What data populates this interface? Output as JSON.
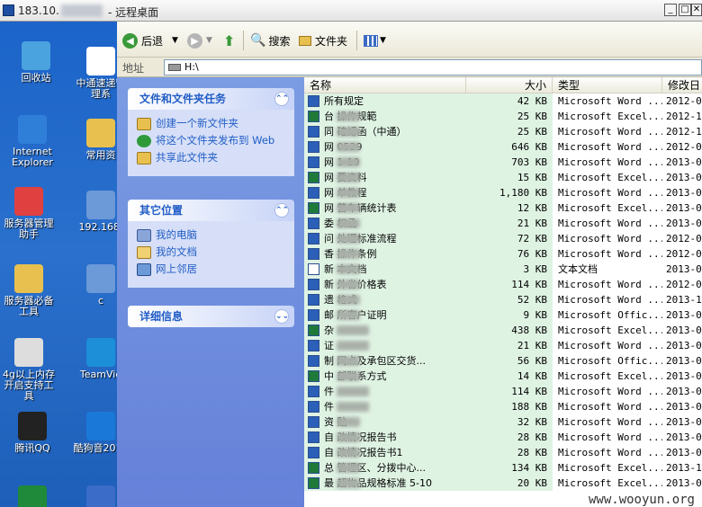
{
  "remote_window": {
    "title_prefix": "183.10.",
    "title_suffix": "- 远程桌面",
    "btn_minimize": "_",
    "btn_restore": "□",
    "btn_close": "✕"
  },
  "desktop_icons": [
    {
      "label": "回收站"
    },
    {
      "label": "中通速递管理系"
    },
    {
      "label": "Internet Explorer"
    },
    {
      "label": "常用资"
    },
    {
      "label": "服务器管理助手"
    },
    {
      "label": "192.168."
    },
    {
      "label": "服务器必备工具"
    },
    {
      "label": "c"
    },
    {
      "label": "4g以上内存开启支持工具"
    },
    {
      "label": "TeamVie"
    },
    {
      "label": "腾讯QQ"
    },
    {
      "label": "酷狗音2012"
    },
    {
      "label": ""
    },
    {
      "label": ""
    }
  ],
  "toolbar": {
    "back": "后退",
    "search": "搜索",
    "folders": "文件夹"
  },
  "address": {
    "label": "地址",
    "value": "H:\\"
  },
  "panels": {
    "tasks": {
      "title": "文件和文件夹任务",
      "links": [
        "创建一个新文件夹",
        "将这个文件夹发布到 Web",
        "共享此文件夹"
      ]
    },
    "places": {
      "title": "其它位置",
      "links": [
        "我的电脑",
        "我的文档",
        "网上邻居"
      ]
    },
    "details": {
      "title": "详细信息"
    }
  },
  "columns": {
    "name": "名称",
    "size": "大小",
    "type": "类型",
    "modified": "修改日"
  },
  "files": [
    {
      "name": "所有规定",
      "size": "42 KB",
      "type": "Microsoft Word ...",
      "mod": "2012-0"
    },
    {
      "name": "台 操作规範",
      "size": "25 KB",
      "type": "Microsoft Excel...",
      "mod": "2012-1"
    },
    {
      "name": "同 確認函（中通）",
      "size": "25 KB",
      "type": "Microsoft Word ...",
      "mod": "2012-1"
    },
    {
      "name": "网 0529",
      "size": "646 KB",
      "type": "Microsoft Word ...",
      "mod": "2012-0"
    },
    {
      "name": "网 1-10",
      "size": "703 KB",
      "type": "Microsoft Word ...",
      "mod": "2013-0"
    },
    {
      "name": "网 要资料",
      "size": "15 KB",
      "type": "Microsoft Excel...",
      "mod": "2013-0"
    },
    {
      "name": "网 单教程",
      "size": "1,180 KB",
      "type": "Microsoft Word ...",
      "mod": "2013-0"
    },
    {
      "name": "网 营车辆统计表",
      "size": "12 KB",
      "type": "Microsoft Excel...",
      "mod": "2013-0"
    },
    {
      "name": "委 权函",
      "size": "21 KB",
      "type": "Microsoft Word ...",
      "mod": "2013-0"
    },
    {
      "name": "问 处理标准流程",
      "size": "72 KB",
      "type": "Microsoft Word ...",
      "mod": "2012-0"
    },
    {
      "name": "香 操作条例",
      "size": "76 KB",
      "type": "Microsoft Word ...",
      "mod": "2012-0"
    },
    {
      "name": "新 本文档",
      "size": "3 KB",
      "type": "文本文档",
      "mod": "2013-0"
    },
    {
      "name": "新 外省价格表",
      "size": "114 KB",
      "type": "Microsoft Word ...",
      "mod": "2012-0"
    },
    {
      "name": "遗 格式",
      "size": "52 KB",
      "type": "Microsoft Word ...",
      "mod": "2013-1"
    },
    {
      "name": "邮 所客户证明",
      "size": "9 KB",
      "type": "Microsoft Offic...",
      "mod": "2013-0"
    },
    {
      "name": "杂",
      "size": "438 KB",
      "type": "Microsoft Excel...",
      "mod": "2013-0"
    },
    {
      "name": "证",
      "size": "21 KB",
      "type": "Microsoft Word ...",
      "mod": "2013-0"
    },
    {
      "name": "制 网点及承包区交货...",
      "size": "56 KB",
      "type": "Microsoft Offic...",
      "mod": "2013-0"
    },
    {
      "name": "中 部联系方式",
      "size": "14 KB",
      "type": "Microsoft Excel...",
      "mod": "2013-0"
    },
    {
      "name": "件",
      "size": "114 KB",
      "type": "Microsoft Word ...",
      "mod": "2013-0"
    },
    {
      "name": "件",
      "size": "188 KB",
      "type": "Microsoft Word ...",
      "mod": "2013-0"
    },
    {
      "name": "资 贴",
      "size": "32 KB",
      "type": "Microsoft Word ...",
      "mod": "2013-0"
    },
    {
      "name": "自 改情况报告书",
      "size": "28 KB",
      "type": "Microsoft Word ...",
      "mod": "2013-0"
    },
    {
      "name": "自 改情况报告书1",
      "size": "28 KB",
      "type": "Microsoft Word ...",
      "mod": "2013-0"
    },
    {
      "name": "总 管理区、分拨中心...",
      "size": "134 KB",
      "type": "Microsoft Excel...",
      "mod": "2013-1"
    },
    {
      "name": "最 超物品规格标准 5-10",
      "size": "20 KB",
      "type": "Microsoft Excel...",
      "mod": "2013-0"
    }
  ],
  "watermark": "www.wooyun.org",
  "colors": {
    "task_pane": "#6f8fe0",
    "panel_header_text": "#215dc6",
    "name_col_bg": "#dff3e3",
    "desktop": "#1f5fb8"
  }
}
